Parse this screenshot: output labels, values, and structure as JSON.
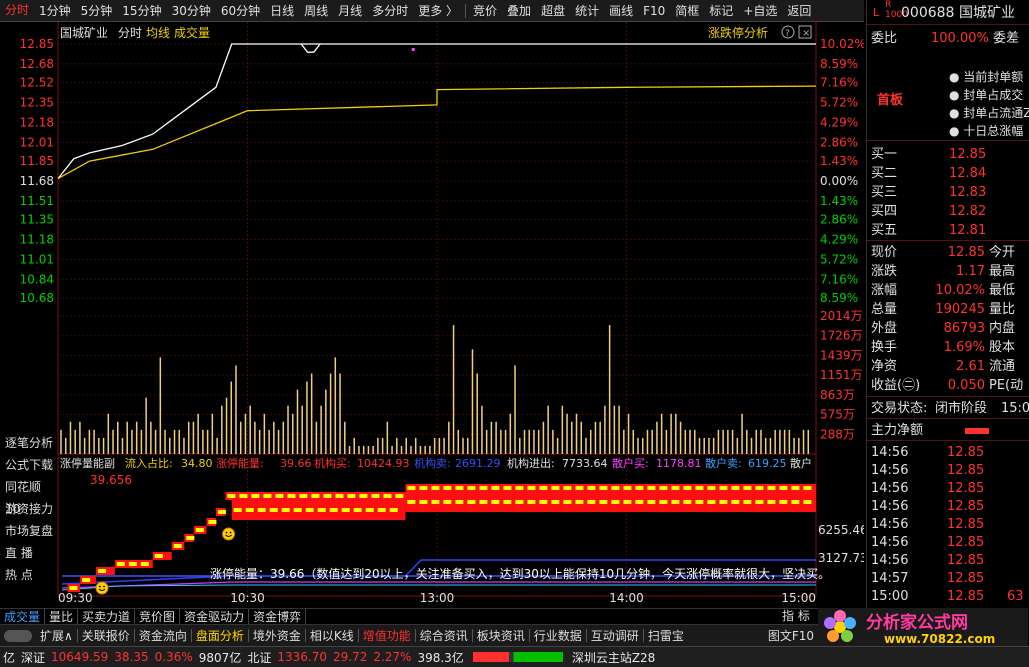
{
  "topbar": {
    "tabs": [
      "分时",
      "1分钟",
      "5分钟",
      "15分钟",
      "30分钟",
      "60分钟",
      "日线",
      "周线",
      "月线",
      "多分时",
      "更多 〉"
    ],
    "tools": [
      "竞价",
      "叠加",
      "超盘",
      "统计",
      "画线",
      "F10",
      "简框",
      "标记",
      "+自选",
      "返回"
    ]
  },
  "main": {
    "stock_name": "国城矿业",
    "mode": "分时",
    "legend_avg": "均线",
    "legend_vol": "成交量",
    "limit_label": "涨跌停分析",
    "price_ticks": [
      "12.85",
      "12.68",
      "12.52",
      "12.35",
      "12.18",
      "12.01",
      "11.85",
      "11.68",
      "11.51",
      "11.35",
      "11.18",
      "11.01",
      "10.84",
      "10.68"
    ],
    "pct_ticks": [
      "10.02%",
      "8.59%",
      "7.16%",
      "5.72%",
      "4.29%",
      "2.86%",
      "1.43%",
      "0.00%",
      "1.43%",
      "2.86%",
      "4.29%",
      "5.72%",
      "7.16%",
      "8.59%"
    ],
    "vol_ticks": [
      "2014万",
      "1726万",
      "1439万",
      "1151万",
      "863万",
      "575万",
      "288万"
    ],
    "time_labels": [
      "09:30",
      "10:30",
      "13:00",
      "14:00",
      "15:00"
    ]
  },
  "indicator": {
    "title": "涨停量能副",
    "inflow_label": "流入占比:",
    "inflow_value": "34.80",
    "energy_label": "涨停能量:",
    "energy_value": "39.66",
    "inst_buy_label": "机构买:",
    "inst_buy_value": "10424.93",
    "inst_sell_label": "机构卖:",
    "inst_sell_value": "2691.29",
    "inst_net_label": "机构进出:",
    "inst_net_value": "7733.64",
    "retail_buy_label": "散户买:",
    "retail_buy_value": "1178.81",
    "retail_sell_label": "散户卖:",
    "retail_sell_value": "619.25",
    "retail_net_label": "散户",
    "marker_value": "39.656",
    "right_ticks": [
      "6255.46",
      "3127.73"
    ],
    "note": "涨停能量：39.66（数值达到20以上，关注准备买入，达到30以上能保持10几分钟，今天涨停概率就很大，坚决买。"
  },
  "left_menu": [
    "逐笔分析",
    "公式下载",
    "同花顺10",
    "游资接力",
    "市场复盘",
    "直  播",
    "热  点"
  ],
  "bottom_tabs": [
    "成交量",
    "量比",
    "买卖力道",
    "竞价图",
    "资金驱动力",
    "资金博弈"
  ],
  "bottom_right": "指 标",
  "toolbar2": {
    "items": [
      "扩展∧",
      "关联报价",
      "资金流向",
      "盘面分析",
      "境外资金",
      "相以K线",
      "增值功能",
      "综合资讯",
      "板块资讯",
      "行业数据",
      "互动调研",
      "扫雷宝",
      "图文F10"
    ]
  },
  "statusbar": {
    "prefix": "亿",
    "sz_label": "深证",
    "sz_value": "10649.59",
    "sz_change": "38.35",
    "sz_pct": "0.36%",
    "sz_amount": "9807亿",
    "bz_label": "北证",
    "bz_value": "1336.70",
    "bz_change": "29.72",
    "bz_pct": "2.27%",
    "bz_amount": "398.3亿",
    "news": "深圳云主站Z28"
  },
  "right_panel": {
    "code": "000688",
    "name": "国城矿业",
    "weibi_label": "委比",
    "weibi_value": "100.00%",
    "weicha_label": "委差",
    "first_board": "首板",
    "info_lines": [
      "当前封单额",
      "封单占成交",
      "封单占流通Z",
      "十日总涨幅"
    ],
    "bids": [
      {
        "label": "买一",
        "price": "12.85"
      },
      {
        "label": "买二",
        "price": "12.84"
      },
      {
        "label": "买三",
        "price": "12.83"
      },
      {
        "label": "买四",
        "price": "12.82"
      },
      {
        "label": "买五",
        "price": "12.81"
      }
    ],
    "quote": [
      {
        "label": "现价",
        "value": "12.85",
        "label2": "今开"
      },
      {
        "label": "涨跌",
        "value": "1.17",
        "label2": "最高"
      },
      {
        "label": "涨幅",
        "value": "10.02%",
        "label2": "最低"
      },
      {
        "label": "总量",
        "value": "190245",
        "label2": "量比"
      },
      {
        "label": "外盘",
        "value": "86793",
        "label2": "内盘"
      },
      {
        "label": "换手",
        "value": "1.69%",
        "label2": "股本"
      },
      {
        "label": "净资",
        "value": "2.61",
        "label2": "流通"
      },
      {
        "label": "收益(㊁)",
        "value": "0.050",
        "label2": "PE(动"
      }
    ],
    "trade_status_label": "交易状态:",
    "trade_status_value": "闭市阶段",
    "trade_status_time": "15:0",
    "netflow_label": "主力净额",
    "ticks": [
      {
        "time": "14:56",
        "price": "12.85",
        "vol": ""
      },
      {
        "time": "14:56",
        "price": "12.85",
        "vol": ""
      },
      {
        "time": "14:56",
        "price": "12.85",
        "vol": ""
      },
      {
        "time": "14:56",
        "price": "12.85",
        "vol": ""
      },
      {
        "time": "14:56",
        "price": "12.85",
        "vol": ""
      },
      {
        "time": "14:56",
        "price": "12.85",
        "vol": ""
      },
      {
        "time": "14:56",
        "price": "12.85",
        "vol": ""
      },
      {
        "time": "14:57",
        "price": "12.85",
        "vol": ""
      },
      {
        "time": "15:00",
        "price": "12.85",
        "vol": "63"
      }
    ]
  },
  "logo": {
    "text": "分析家公式网",
    "url": "www.70822.com"
  },
  "chart_data": [
    {
      "type": "line",
      "series": [
        {
          "name": "分时",
          "x": [
            "09:30",
            "09:35",
            "09:40",
            "09:50",
            "10:00",
            "10:10",
            "10:20",
            "10:25",
            "10:30",
            "11:30",
            "13:00",
            "14:00",
            "15:00"
          ],
          "values": [
            11.7,
            11.87,
            11.92,
            11.98,
            12.08,
            12.28,
            12.48,
            12.85,
            12.85,
            12.85,
            12.85,
            12.85,
            12.85
          ]
        },
        {
          "name": "均线",
          "x": [
            "09:30",
            "09:40",
            "10:00",
            "10:20",
            "10:30",
            "11:30",
            "13:00",
            "14:00",
            "15:00"
          ],
          "values": [
            11.7,
            11.85,
            11.95,
            12.17,
            12.28,
            12.33,
            12.46,
            12.48,
            12.49
          ]
        }
      ],
      "ylim": [
        10.68,
        12.85
      ],
      "xlabel": "",
      "ylabel": ""
    },
    {
      "type": "bar",
      "series": [
        {
          "name": "成交量",
          "values": [
            3,
            2,
            4,
            3,
            4,
            2,
            3,
            3,
            2,
            2,
            5,
            3,
            4,
            2,
            4,
            3,
            4,
            3,
            7,
            4,
            3,
            12,
            3,
            2,
            3,
            3,
            2,
            4,
            4,
            5,
            3,
            3,
            5,
            2,
            6,
            7,
            9,
            11,
            4,
            5,
            6,
            4,
            3,
            5,
            3,
            4,
            3,
            4,
            6,
            5,
            8,
            6,
            9,
            10,
            4,
            6,
            8,
            10,
            12,
            10,
            4,
            1,
            2,
            1,
            1,
            1,
            1,
            2,
            2,
            4,
            1,
            2,
            1,
            2,
            1,
            2,
            1,
            1,
            1,
            2,
            2,
            2,
            4,
            16,
            3,
            2,
            2,
            13,
            10,
            6,
            3,
            4,
            4,
            3,
            3,
            5,
            11,
            2,
            3,
            3,
            3,
            3,
            4,
            6,
            3,
            2,
            6,
            5,
            4,
            5,
            4,
            2,
            3,
            4,
            4,
            6,
            16,
            6,
            6,
            3,
            5,
            3,
            2,
            2,
            3,
            3,
            4,
            5,
            3,
            5,
            5,
            4,
            3,
            3,
            3,
            2,
            2,
            2,
            2,
            3,
            3,
            3,
            3,
            2,
            5,
            3,
            2,
            3,
            3,
            2,
            2,
            3,
            3,
            3,
            3,
            2,
            2,
            3,
            3
          ]
        }
      ],
      "ylim": [
        0,
        2014
      ]
    }
  ]
}
